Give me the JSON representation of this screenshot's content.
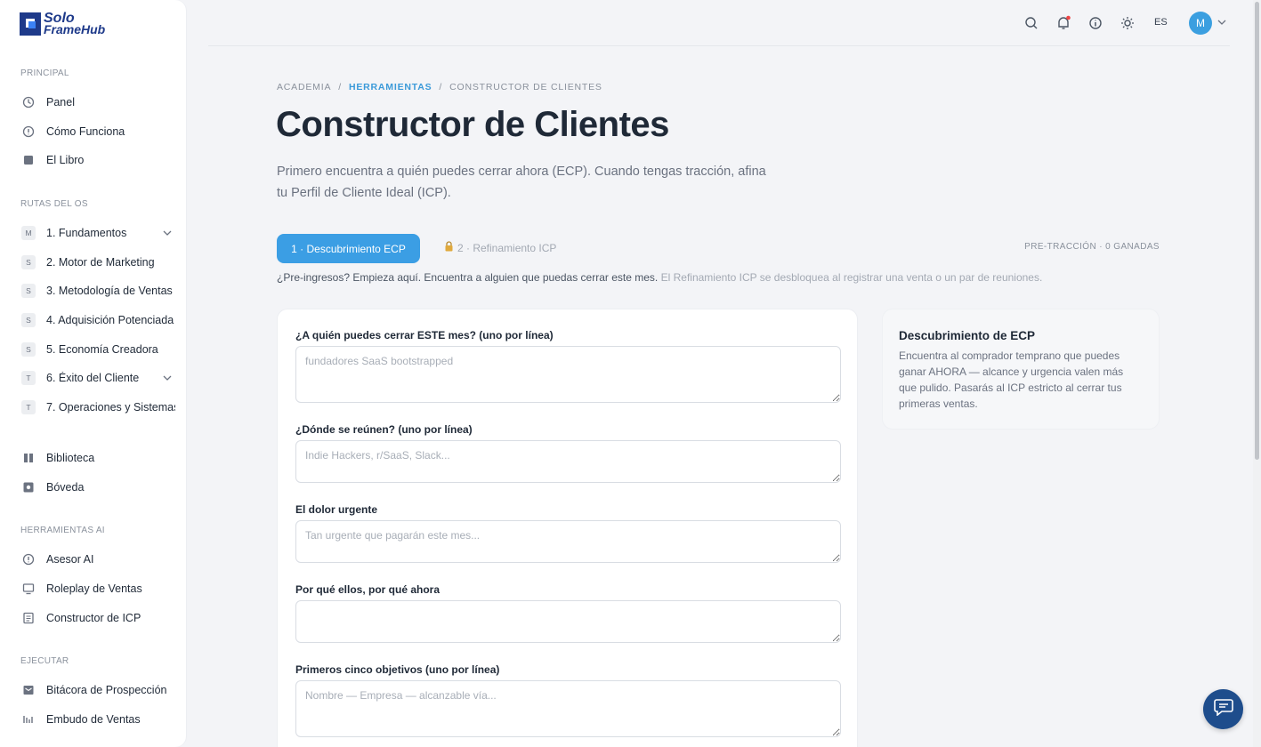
{
  "brand": {
    "line1": "Solo",
    "line2": "FrameHub"
  },
  "sidebar": {
    "sections": {
      "principal": "PRINCIPAL",
      "rutas": "RUTAS DEL OS",
      "herramientas": "HERRAMIENTAS AI",
      "ejecutar": "EJECUTAR"
    },
    "principal": [
      {
        "label": "Panel",
        "icon": "dashboard-icon"
      },
      {
        "label": "Cómo Funciona",
        "icon": "info-icon"
      },
      {
        "label": "El Libro",
        "icon": "book-icon"
      }
    ],
    "rutas": [
      {
        "badge": "M",
        "label": "1. Fundamentos"
      },
      {
        "badge": "S",
        "label": "2. Motor de Marketing"
      },
      {
        "badge": "S",
        "label": "3. Metodología de Ventas"
      },
      {
        "badge": "S",
        "label": "4. Adquisición Potenciada"
      },
      {
        "badge": "S",
        "label": "5. Economía Creadora"
      },
      {
        "badge": "T",
        "label": "6. Éxito del Cliente"
      },
      {
        "badge": "T",
        "label": "7. Operaciones y Sistemas"
      }
    ],
    "library": [
      {
        "label": "Biblioteca",
        "icon": "library-icon"
      },
      {
        "label": "Bóveda",
        "icon": "vault-icon"
      }
    ],
    "herramientas": [
      {
        "label": "Asesor AI",
        "icon": "advisor-icon"
      },
      {
        "label": "Roleplay de Ventas",
        "icon": "monitor-icon"
      },
      {
        "label": "Constructor de ICP",
        "icon": "document-icon"
      }
    ],
    "ejecutar": [
      {
        "label": "Bitácora de Prospección",
        "icon": "inbox-icon"
      },
      {
        "label": "Embudo de Ventas",
        "icon": "bars-icon"
      }
    ]
  },
  "topbar": {
    "language": "ES",
    "avatar_initial": "M"
  },
  "breadcrumb": [
    "ACADEMIA",
    "HERRAMIENTAS",
    "CONSTRUCTOR DE CLIENTES"
  ],
  "page": {
    "title": "Constructor de Clientes",
    "subtitle": "Primero encuentra a quién puedes cerrar ahora (ECP). Cuando tengas tracción, afina tu Perfil de Cliente Ideal (ICP)."
  },
  "tabs": {
    "active": "1 · Descubrimiento ECP",
    "locked": "2 · Refinamiento ICP",
    "status": "PRE-TRACCIÓN · 0 GANADAS"
  },
  "hint": {
    "main": "¿Pre-ingresos? Empieza aquí. Encuentra a alguien que puedas cerrar este mes.",
    "muted": "El Refinamiento ICP se desbloquea al registrar una venta o un par de reuniones."
  },
  "form": [
    {
      "label": "¿A quién puedes cerrar ESTE mes? (uno por línea)",
      "placeholder": "fundadores SaaS bootstrapped"
    },
    {
      "label": "¿Dónde se reúnen? (uno por línea)",
      "placeholder": "Indie Hackers, r/SaaS, Slack..."
    },
    {
      "label": "El dolor urgente",
      "placeholder": "Tan urgente que pagarán este mes..."
    },
    {
      "label": "Por qué ellos, por qué ahora",
      "placeholder": ""
    },
    {
      "label": "Primeros cinco objetivos (uno por línea)",
      "placeholder": "Nombre — Empresa — alcanzable vía..."
    }
  ],
  "info": {
    "title": "Descubrimiento de ECP",
    "body": "Encuentra al comprador temprano que puedes ganar AHORA — alcance y urgencia valen más que pulido. Pasarás al ICP estricto al cerrar tus primeras ventas."
  },
  "colors": {
    "accent": "#3b9ee4",
    "brand": "#1e3a8a",
    "notification": "#ef4444"
  }
}
